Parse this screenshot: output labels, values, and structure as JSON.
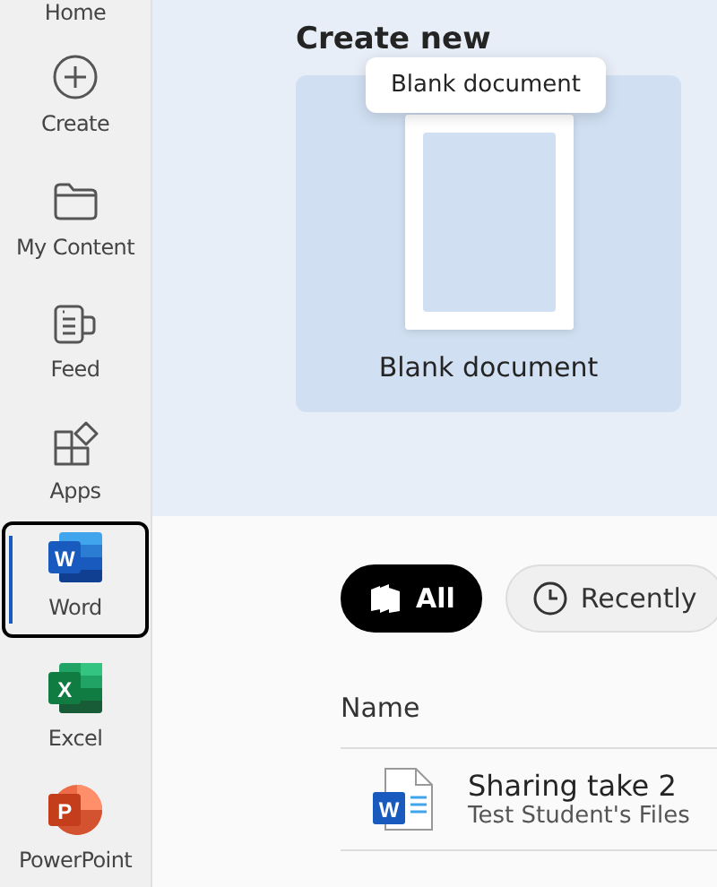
{
  "sidebar": {
    "items": [
      {
        "label": "Home",
        "selected": false
      },
      {
        "label": "Create",
        "selected": false
      },
      {
        "label": "My Content",
        "selected": false
      },
      {
        "label": "Feed",
        "selected": false
      },
      {
        "label": "Apps",
        "selected": false
      },
      {
        "label": "Word",
        "selected": true,
        "icon_letter": "W"
      },
      {
        "label": "Excel",
        "selected": false,
        "icon_letter": "X"
      },
      {
        "label": "PowerPoint",
        "selected": false,
        "icon_letter": "P"
      }
    ]
  },
  "create_new": {
    "title": "Create new",
    "tooltip": "Blank document",
    "cards": [
      {
        "label": "Blank document"
      }
    ]
  },
  "filters": [
    {
      "label": "All",
      "selected": true
    },
    {
      "label": "Recently",
      "selected": false
    }
  ],
  "table": {
    "columns": [
      "Name"
    ],
    "rows": [
      {
        "icon_letter": "W",
        "name": "Sharing take 2",
        "location": "Test Student's Files"
      }
    ]
  }
}
